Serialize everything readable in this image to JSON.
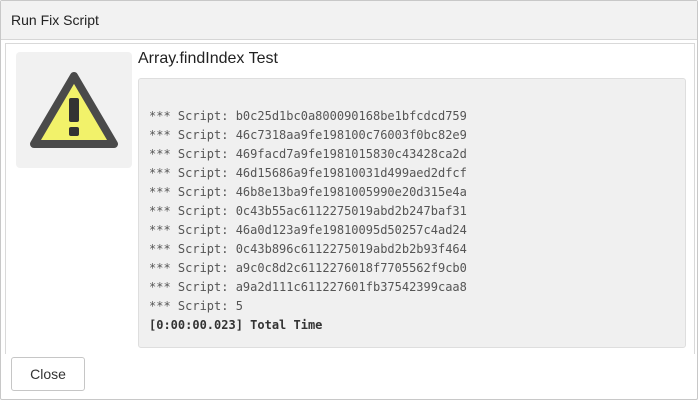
{
  "dialog": {
    "title": "Run Fix Script",
    "heading": "Array.findIndex Test",
    "icon": "warning-icon",
    "output_lines": [
      "*** Script: b0c25d1bc0a800090168be1bfcdcd759",
      "*** Script: 46c7318aa9fe198100c76003f0bc82e9",
      "*** Script: 469facd7a9fe1981015830c43428ca2d",
      "*** Script: 46d15686a9fe19810031d499aed2dfcf",
      "*** Script: 46b8e13ba9fe1981005990e20d315e4a",
      "*** Script: 0c43b55ac6112275019abd2b247baf31",
      "*** Script: 46a0d123a9fe19810095d50257c4ad24",
      "*** Script: 0c43b896c6112275019abd2b2b93f464",
      "*** Script: a9c0c8d2c6112276018f7705562f9cb0",
      "*** Script: a9a2d111c611227601fb37542399caa8",
      "*** Script: 5"
    ],
    "total_time": "[0:00:00.023] Total Time",
    "close_label": "Close"
  },
  "colors": {
    "warning_fill": "#f2f26a",
    "warning_stroke": "#4a4a4a"
  }
}
